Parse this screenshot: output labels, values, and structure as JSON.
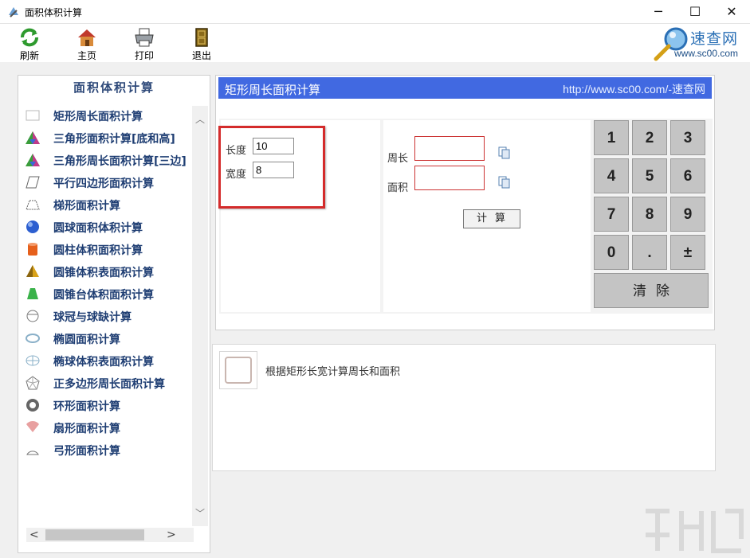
{
  "window": {
    "title": "面积体积计算",
    "minimize_glyph": "─",
    "maximize_glyph": "☐",
    "close_glyph": "✕"
  },
  "toolbar": {
    "refresh_label": "刷新",
    "home_label": "主页",
    "print_label": "打印",
    "exit_label": "退出"
  },
  "brand": {
    "name": "速查网",
    "url": "www.sc00.com"
  },
  "sidebar": {
    "header": "面积体积计算",
    "items": [
      {
        "label": "矩形周长面积计算",
        "icon": "rectangle-icon"
      },
      {
        "label": "三角形面积计算[底和高]",
        "icon": "triangle-color-icon"
      },
      {
        "label": "三角形周长面积计算[三边]",
        "icon": "triangle-color-icon"
      },
      {
        "label": "平行四边形面积计算",
        "icon": "parallelogram-icon"
      },
      {
        "label": "梯形面积计算",
        "icon": "trapezoid-icon"
      },
      {
        "label": "圆球面积体积计算",
        "icon": "sphere-icon"
      },
      {
        "label": "圆柱体积面积计算",
        "icon": "cylinder-icon"
      },
      {
        "label": "圆锥体积表面积计算",
        "icon": "cone-icon"
      },
      {
        "label": "圆锥台体积面积计算",
        "icon": "frustum-icon"
      },
      {
        "label": "球冠与球缺计算",
        "icon": "spherical-cap-icon"
      },
      {
        "label": "椭圆面积计算",
        "icon": "ellipse-icon"
      },
      {
        "label": "椭球体积表面积计算",
        "icon": "ellipsoid-icon"
      },
      {
        "label": "正多边形周长面积计算",
        "icon": "polygon-icon"
      },
      {
        "label": "环形面积计算",
        "icon": "ring-icon"
      },
      {
        "label": "扇形面积计算",
        "icon": "sector-icon"
      },
      {
        "label": "弓形面积计算",
        "icon": "segment-icon"
      }
    ],
    "scroll_up": "︿",
    "scroll_down": "﹀",
    "scroll_left": "<",
    "scroll_right": ">"
  },
  "calc": {
    "title": "矩形周长面积计算",
    "url": "http://www.sc00.com/-速查网",
    "length_label": "长度",
    "length_value": "10",
    "width_label": "宽度",
    "width_value": "8",
    "perimeter_label": "周长",
    "perimeter_value": "",
    "area_label": "面积",
    "area_value": "",
    "calculate_label": "计算",
    "keypad": [
      "1",
      "2",
      "3",
      "4",
      "5",
      "6",
      "7",
      "8",
      "9",
      "0",
      ".",
      "±"
    ],
    "clear_label": "清除"
  },
  "description": {
    "text": "根据矩形长宽计算周长和面积"
  },
  "colors": {
    "header_blue": "#4169e1",
    "highlight_red": "#d42b2b",
    "sidebar_text": "#1f3e73"
  }
}
